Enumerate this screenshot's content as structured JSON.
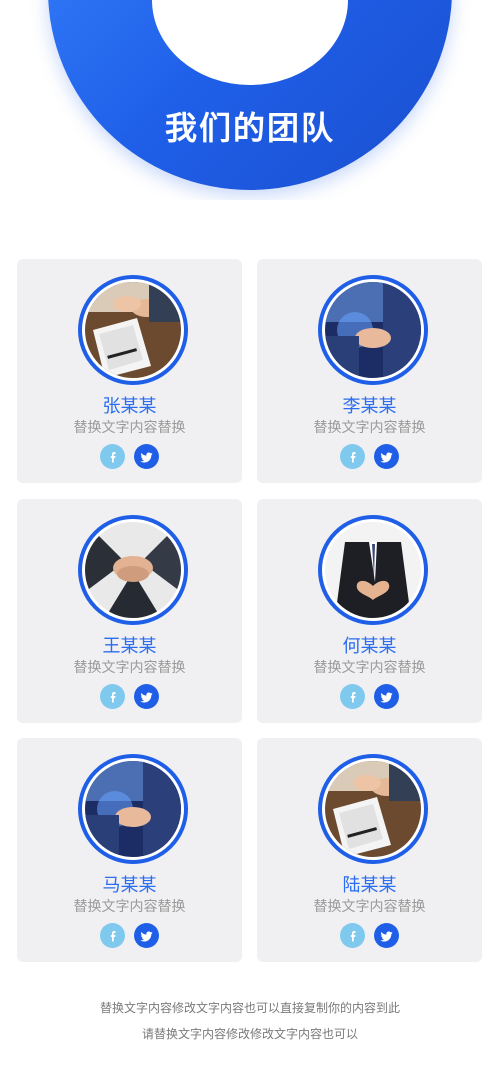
{
  "header": {
    "title": "我们的团队"
  },
  "team": [
    {
      "name": "张某某",
      "role": "替换文字内容替换",
      "photo": "handshake-icon"
    },
    {
      "name": "李某某",
      "role": "替换文字内容替换",
      "photo": "handshake-icon"
    },
    {
      "name": "王某某",
      "role": "替换文字内容替换",
      "photo": "stacked-hands-icon"
    },
    {
      "name": "何某某",
      "role": "替换文字内容替换",
      "photo": "heart-hands-icon"
    },
    {
      "name": "马某某",
      "role": "替换文字内容替换",
      "photo": "handshake-icon"
    },
    {
      "name": "陆某某",
      "role": "替换文字内容替换",
      "photo": "handshake-icon"
    }
  ],
  "footer": {
    "line1": "替换文字内容修改文字内容也可以直接复制你的内容到此",
    "line2": "请替换文字内容修改修改文字内容也可以"
  },
  "colors": {
    "brand": "#1f5fe8",
    "light_blue": "#7fc8ee",
    "card_bg": "#f0f0f2",
    "name": "#2a6df0",
    "role": "#9a9a9a"
  }
}
